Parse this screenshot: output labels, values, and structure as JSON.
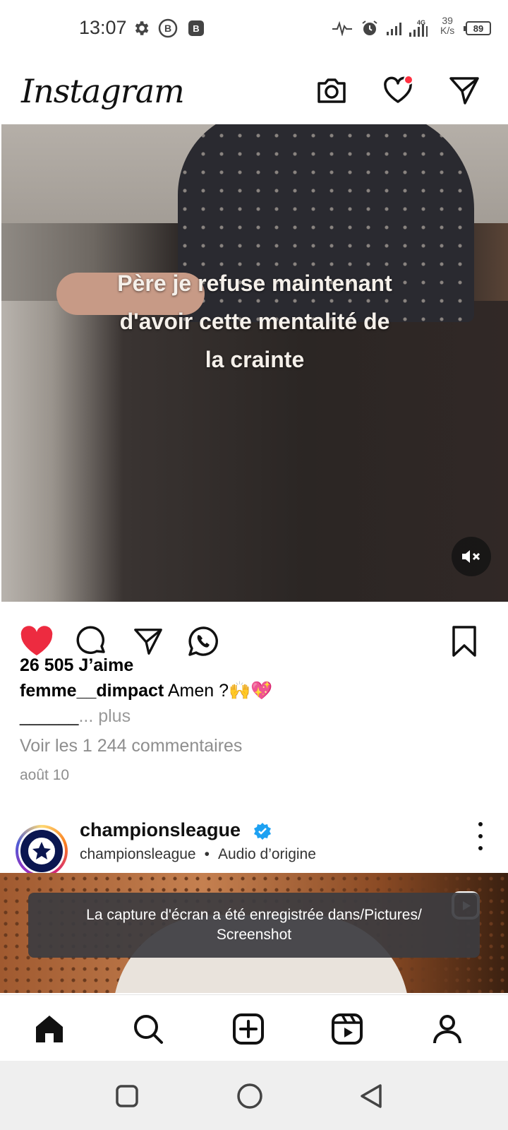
{
  "status_bar": {
    "time": "13:07",
    "network_type": "4G",
    "speed_value": "39",
    "speed_unit": "K/s",
    "battery": "89",
    "icons": [
      "gear-icon",
      "b-icon",
      "b-square-icon",
      "activity-icon",
      "alarm-icon",
      "signal-icon",
      "signal-4g-icon"
    ]
  },
  "header": {
    "logo": "Instagram",
    "icons": [
      "camera-icon",
      "heart-icon",
      "send-icon"
    ],
    "notification_color": "#ff3040"
  },
  "post": {
    "overlay_text_line1": "Père je refuse maintenant",
    "overlay_text_line2": "d'avoir cette mentalité de",
    "overlay_text_line3": "la crainte",
    "likes": "26 505 J’aime",
    "username": "femme__dimpact",
    "caption": "Amen ?🙌💖",
    "caption_more_prefix": "______",
    "caption_more": "... plus",
    "comments_link": "Voir les 1 244 commentaires",
    "date": "août 10",
    "liked": true,
    "like_color": "#ed2b40"
  },
  "next_post": {
    "username": "championsleague",
    "subtitle_account": "championsleague",
    "subtitle_audio": "Audio d’origine",
    "verified_color": "#1da1f2"
  },
  "toast": {
    "line1": "La capture d'écran a été enregistrée dans/Pictures/",
    "line2": "Screenshot"
  },
  "bottom_nav": [
    "home-icon",
    "search-icon",
    "create-icon",
    "reels-icon",
    "profile-icon"
  ],
  "system_nav": [
    "recents-icon",
    "home-circle-icon",
    "back-icon"
  ]
}
